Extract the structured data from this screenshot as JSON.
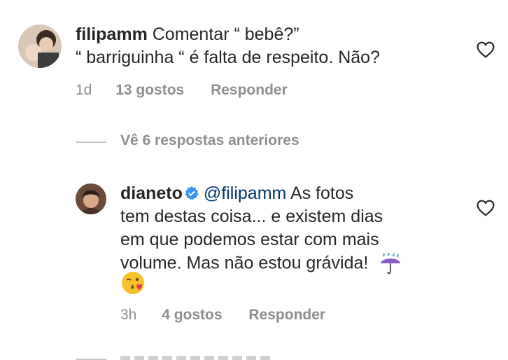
{
  "comment1": {
    "username": "filipamm",
    "text_line1": "Comentar “ bebê?”",
    "text_line2": "“ barriguinha “ é falta de respeito. Não?",
    "time": "1d",
    "likes": "13 gostos",
    "reply": "Responder"
  },
  "view_replies": "Vê 6 respostas anteriores",
  "comment2": {
    "username": "dianeto",
    "mention": "@filipamm",
    "text_line1_rest": "As fotos",
    "text_line2": "tem destas coisa... e existem dias",
    "text_line3": "em que podemos estar com mais",
    "text_line4": "volume. Mas não estou grávida!",
    "time": "3h",
    "likes": "4 gostos",
    "reply": "Responder"
  },
  "icons": {
    "heart": "heart-outline-icon",
    "verified": "verified-badge-icon",
    "umbrella": "umbrella-rain-emoji",
    "kiss": "kissing-face-emoji"
  },
  "colors": {
    "text": "#262626",
    "secondary": "#8e8e8e",
    "mention": "#00376b",
    "verified": "#3897f0"
  }
}
